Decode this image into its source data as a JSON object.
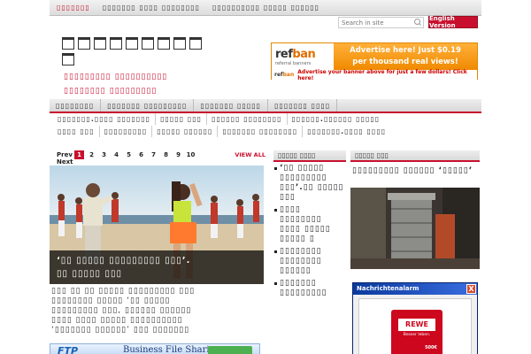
{
  "topnav": {
    "items": [
      "▯▯▯▯▯▯▯",
      "▯▯▯▯▯▯▯ ▯▯▯▯ ▯▯▯▯▯▯▯▯",
      "▯▯▯▯▯▯▯▯▯▯ ▯▯▯▯▯ ▯▯▯▯▯▯"
    ]
  },
  "search": {
    "placeholder": "Search in site"
  },
  "english_button": "English Version",
  "tagline": [
    "▯▯▯▯▯▯▯▯▯ ▯▯▯▯▯▯▯▯▯▯",
    "▯▯▯▯▯▯▯▯ ▯▯▯▯▯▯▯▯▯"
  ],
  "ad_banner": {
    "brand_left": "ref",
    "brand_right": "ban",
    "brand_sub": "referral banners",
    "line1": "Advertise here! Just $0.19",
    "line2": "per thousand real views!",
    "bottom_text": "Advertise your banner above for just a few dollars! Click here!"
  },
  "mainnav": [
    "▯▯▯▯▯▯▯▯",
    "▯▯▯▯▯▯▯ ▯▯▯▯▯▯▯▯▯",
    "▯▯▯▯▯▯▯ ▯▯▯▯▯",
    "▯▯▯▯▯▯▯ ▯▯▯▯"
  ],
  "subnav1": [
    "▯▯▯▯▯▯▯.▯▯▯▯ ▯▯▯▯▯▯▯",
    "▯▯▯▯▯ ▯▯▯",
    "▯▯▯▯▯▯ ▯▯▯▯▯▯▯▯",
    "▯▯▯▯▯▯.▯▯▯▯▯▯ ▯▯▯▯▯"
  ],
  "subnav2": [
    "▯▯▯▯ ▯▯▯",
    "▯▯▯▯▯▯▯▯▯",
    "▯▯▯▯▯ ▯▯▯▯▯▯",
    "▯▯▯▯▯▯▯ ▯▯▯▯▯▯▯▯",
    "▯▯▯▯▯▯▯.▯▯▯▯ ▯▯▯▯"
  ],
  "pager": {
    "prev": "Prev",
    "next": "Next",
    "pages": [
      "1",
      "2",
      "3",
      "4",
      "5",
      "6",
      "7",
      "8",
      "9",
      "10"
    ],
    "view_all": "VIEW ALL"
  },
  "featured": {
    "caption_line1": "‘▯▯ ▯▯▯▯▯ ▯▯▯▯▯▯▯▯▯ ▯▯▯’.",
    "caption_line2": "▯▯ ▯▯▯▯▯ ▯▯▯"
  },
  "article_text": [
    "▯▯▯ ▯▯ ▯▯ ▯▯▯▯▯ ▯▯▯▯▯▯▯▯▯ ▯▯▯",
    "▯▯▯▯▯▯▯▯ ▯▯▯▯▯ ‘▯▯ ▯▯▯▯▯",
    "▯▯▯▯▯▯▯▯▯ ▯▯▯, ▯▯▯▯▯▯ ▯▯▯▯▯▯",
    "▯▯▯▯ ▯▯▯▯ ▯▯▯▯▯ ▯▯▯▯▯▯▯▯▯▯",
    "‘▯▯▯▯▯▯▯ ▯▯▯▯▯▯’ ▯▯▯ ▯▯▯▯▯▯▯"
  ],
  "ftp_banner": {
    "logo": "FTP",
    "text": "Business File Sharing"
  },
  "midcol": {
    "heading": "▯▯▯▯▯ ▯▯▯▯",
    "items": [
      "‘▯▯ ▯▯▯▯▯ ▯▯▯▯▯▯▯▯▯ ▯▯▯’.▯▯ ▯▯▯▯▯ ▯▯▯",
      "▯▯▯▯ ▯▯▯▯▯▯▯▯ ▯▯▯▯ ▯▯▯▯▯ ▯▯▯▯▯ ▯",
      "▯▯▯▯▯▯▯▯ ▯▯▯▯▯▯▯▯ ▯▯▯▯▯▯",
      "▯▯▯▯▯▯▯ ▯▯▯▯▯▯▯▯▯"
    ]
  },
  "rightcol": {
    "heading": "▯▯▯▯▯ ▯▯▯",
    "caption": "▯▯▯▯▯▯▯▯▯ ▯▯▯▯▯▯ ‘▯▯▯▯▯’"
  },
  "popup": {
    "title": "Nachrichtenalarm",
    "close": "X",
    "brand": "REWE",
    "slogan": "Besser leben.",
    "value": "500€"
  },
  "colors": {
    "accent": "#c8102e",
    "ad_orange": "#f08a00",
    "popup_bar": "#0a3a9e"
  }
}
